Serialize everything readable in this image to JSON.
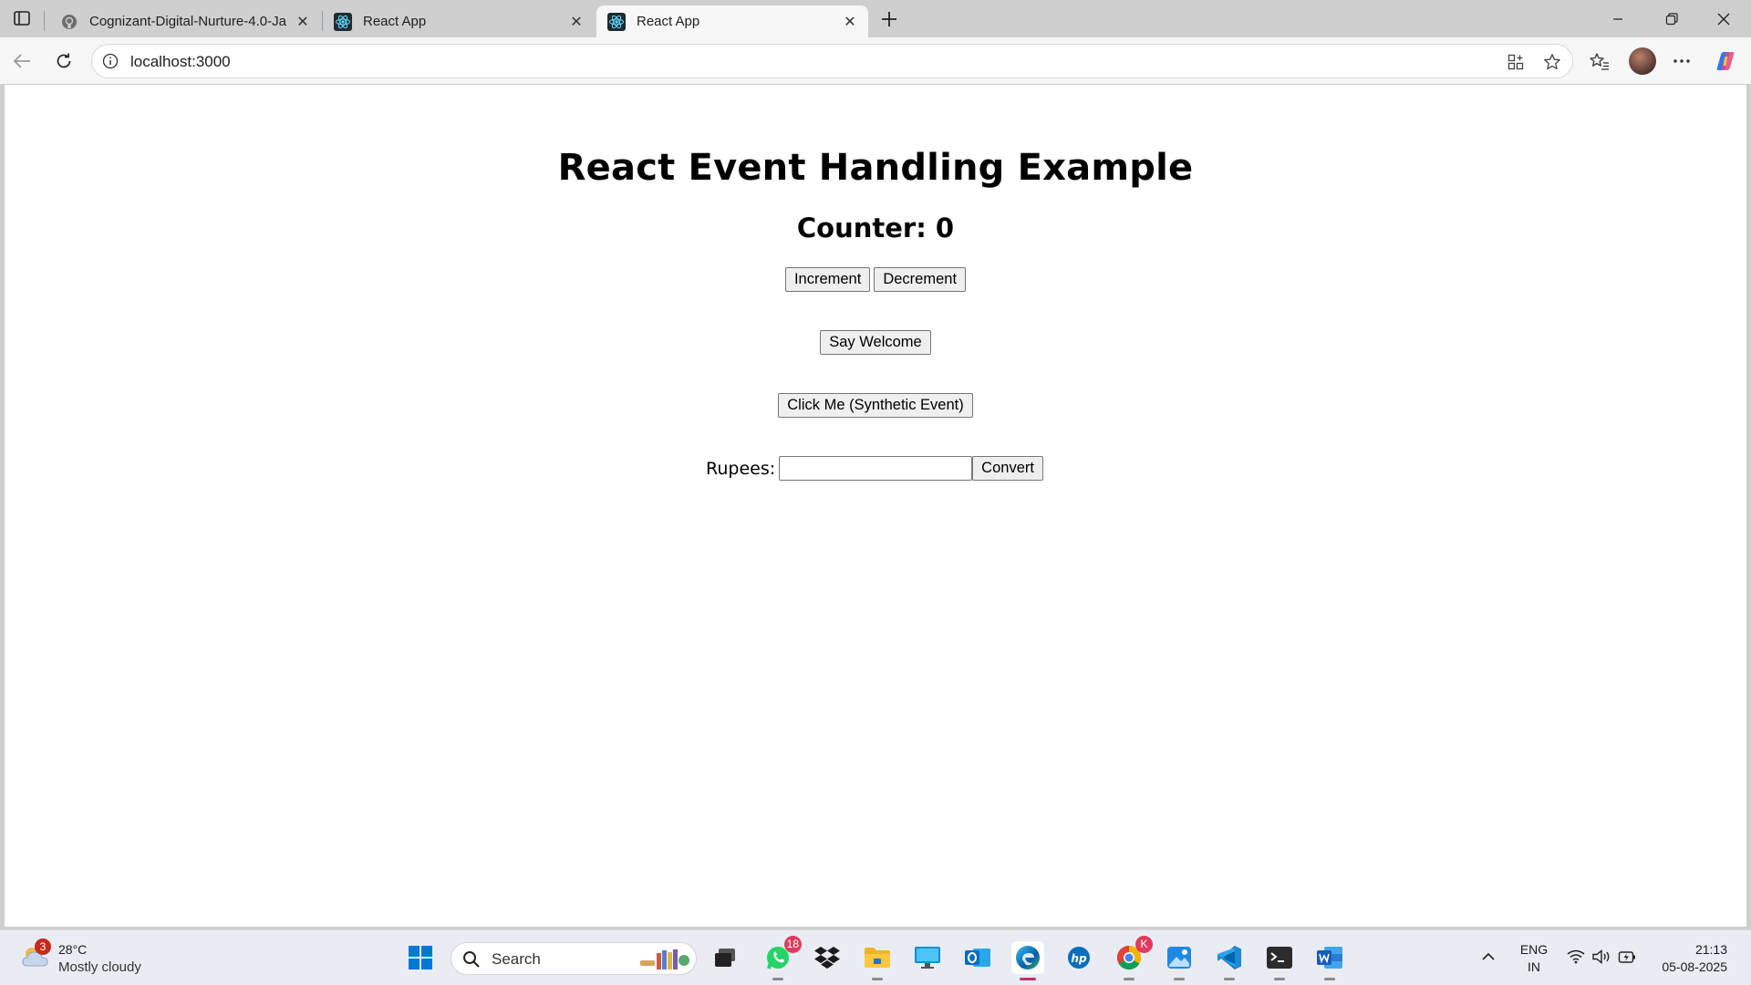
{
  "browser": {
    "tabs": [
      {
        "title": "Cognizant-Digital-Nurture-4.0-Ja",
        "favicon": "github-icon"
      },
      {
        "title": "React App",
        "favicon": "react-icon"
      },
      {
        "title": "React App",
        "favicon": "react-icon",
        "active": true
      }
    ],
    "address": "localhost:3000"
  },
  "page": {
    "heading": "React Event Handling Example",
    "counter_text": "Counter: 0",
    "increment_label": "Increment",
    "decrement_label": "Decrement",
    "welcome_label": "Say Welcome",
    "synthetic_label": "Click Me (Synthetic Event)",
    "rupees_label": "Rupees:",
    "rupees_value": "",
    "convert_label": "Convert"
  },
  "taskbar": {
    "weather_badge": "3",
    "temperature": "28°C",
    "condition": "Mostly cloudy",
    "search_placeholder": "Search",
    "whatsapp_badge": "18",
    "chrome_badge": "K",
    "lang_line1": "ENG",
    "lang_line2": "IN",
    "time": "21:13",
    "date": "05-08-2025"
  },
  "colors": {
    "chrome_bg": "#cfcfcf",
    "toolbar_bg": "#f7f7f7",
    "page_bg": "#ffffff",
    "taskbar_bg": "#e9ecf2",
    "windows_blue": "#0078d4"
  }
}
